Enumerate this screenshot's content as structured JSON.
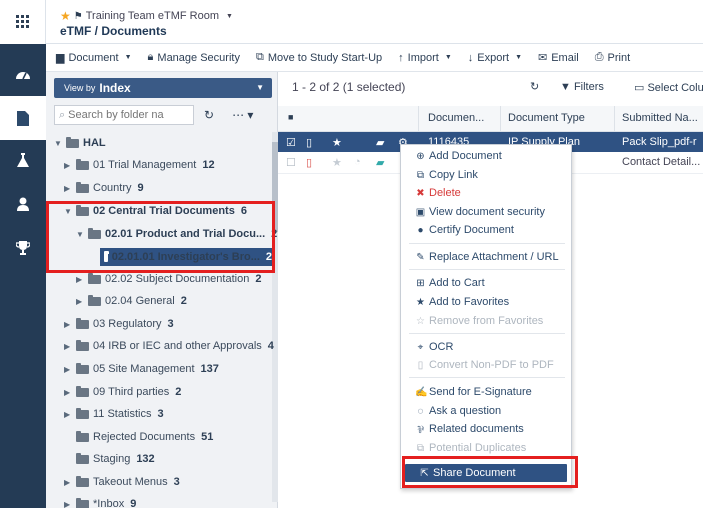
{
  "header": {
    "room": "Training Team eTMF Room",
    "breadcrumb": "eTMF / Documents"
  },
  "rail": {
    "icons": [
      "apps-grid-icon",
      "dashboard-icon",
      "document-icon",
      "flask-icon",
      "user-icon",
      "trophy-icon"
    ]
  },
  "toolbar": {
    "document": "Document",
    "manage_security": "Manage Security",
    "move": "Move to Study Start-Up",
    "import": "Import",
    "export": "Export",
    "email": "Email",
    "print": "Print"
  },
  "left": {
    "view_by_prefix": "View by",
    "view_by_value": "Index",
    "search_placeholder": "Search by folder na",
    "tree": [
      {
        "label": "HAL",
        "count": ""
      },
      {
        "label": "01 Trial Management",
        "count": "12"
      },
      {
        "label": "Country",
        "count": "9"
      },
      {
        "label": "02 Central Trial Documents",
        "count": "6"
      },
      {
        "label": "02.01 Product and Trial Docu...",
        "count": "2"
      },
      {
        "label": "02.01.01 Investigator's Bro...",
        "count": "2"
      },
      {
        "label": "02.02 Subject Documentation",
        "count": "2"
      },
      {
        "label": "02.04 General",
        "count": "2"
      },
      {
        "label": "03 Regulatory",
        "count": "3"
      },
      {
        "label": "04 IRB or IEC and other Approvals",
        "count": "4"
      },
      {
        "label": "05 Site Management",
        "count": "137"
      },
      {
        "label": "09 Third parties",
        "count": "2"
      },
      {
        "label": "11 Statistics",
        "count": "3"
      },
      {
        "label": "Rejected Documents",
        "count": "51"
      },
      {
        "label": "Staging",
        "count": "132"
      },
      {
        "label": "Takeout Menus",
        "count": "3"
      },
      {
        "label": "*Inbox",
        "count": "9"
      }
    ]
  },
  "grid": {
    "selection_info": "1 - 2 of 2 (1 selected)",
    "filters": "Filters",
    "select_columns": "Select Colu",
    "columns": [
      "Documen...",
      "Document Type",
      "Submitted Na..."
    ],
    "rows": [
      {
        "doc_id": "1116435",
        "type": "IP Supply Plan",
        "submitted": "Pack Slip_pdf-r",
        "selected": true
      },
      {
        "doc_id": "",
        "type": "",
        "submitted": "Contact Detail...",
        "selected": false
      }
    ]
  },
  "menu": {
    "items": [
      {
        "label": "Add Document",
        "icon": "plus-circle-icon",
        "state": "normal"
      },
      {
        "label": "Copy Link",
        "icon": "copy-icon",
        "state": "normal"
      },
      {
        "label": "Delete",
        "icon": "x-icon",
        "state": "danger"
      },
      {
        "label": "View document security",
        "icon": "lock-icon",
        "state": "normal"
      },
      {
        "label": "Certify Document",
        "icon": "certificate-icon",
        "state": "normal"
      },
      {
        "label": "Replace Attachment / URL",
        "icon": "pencil-icon",
        "state": "normal"
      },
      {
        "label": "Add to Cart",
        "icon": "cart-icon",
        "state": "normal"
      },
      {
        "label": "Add to Favorites",
        "icon": "star-icon",
        "state": "normal"
      },
      {
        "label": "Remove from Favorites",
        "icon": "star-outline-icon",
        "state": "disabled"
      },
      {
        "label": "OCR",
        "icon": "ocr-icon",
        "state": "normal"
      },
      {
        "label": "Convert Non-PDF to PDF",
        "icon": "convert-icon",
        "state": "disabled"
      },
      {
        "label": "Send for E-Signature",
        "icon": "signature-icon",
        "state": "normal"
      },
      {
        "label": "Ask a question",
        "icon": "comment-icon",
        "state": "normal"
      },
      {
        "label": "Related documents",
        "icon": "related-icon",
        "state": "normal"
      },
      {
        "label": "Potential Duplicates",
        "icon": "duplicate-icon",
        "state": "disabled"
      },
      {
        "label": "Share Document",
        "icon": "share-icon",
        "state": "highlighted"
      }
    ]
  },
  "colors": {
    "nav_dark": "#243b55",
    "selection_blue": "#2f5283",
    "highlight_red": "#e41f1f",
    "star_gold": "#f5a623"
  }
}
